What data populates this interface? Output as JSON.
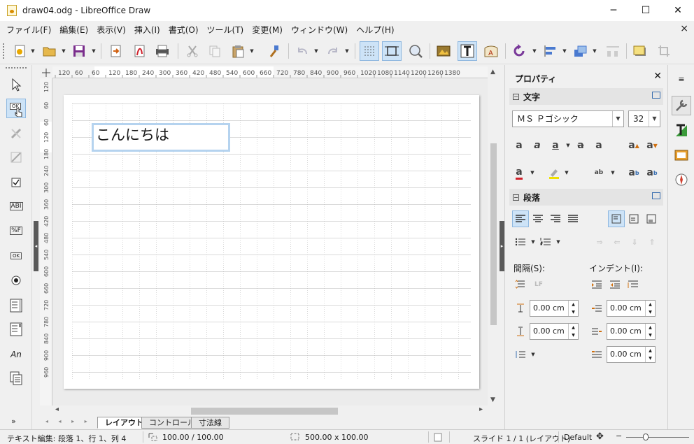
{
  "window": {
    "title": "draw04.odg - LibreOffice Draw",
    "minimize": "─",
    "maximize": "☐",
    "close": "✕"
  },
  "menu": {
    "items": [
      "ファイル(F)",
      "編集(E)",
      "表示(V)",
      "挿入(I)",
      "書式(O)",
      "ツール(T)",
      "変更(M)",
      "ウィンドウ(W)",
      "ヘルプ(H)"
    ],
    "close_doc": "×"
  },
  "toolbar": {
    "icons": [
      "new-document-icon",
      "open-icon",
      "save-icon",
      "export-icon",
      "export-pdf-icon",
      "print-icon",
      "cut-icon",
      "copy-icon",
      "paste-icon",
      "clone-formatting-icon",
      "undo-icon",
      "redo-icon",
      "grid-icon",
      "helplines-icon",
      "zoom-icon",
      "image-icon",
      "text-box-icon",
      "fontwork-icon",
      "rotate-icon",
      "align-icon",
      "arrange-icon",
      "distribute-icon",
      "shadow-icon",
      "crop-icon"
    ]
  },
  "controls_bar": {
    "more_label": "»",
    "icons": [
      "select-icon",
      "push-button-icon",
      "design-mode-icon",
      "control-properties-icon",
      "check-box-icon",
      "text-field-icon",
      "formatted-field-icon",
      "form-button-icon",
      "option-button-icon",
      "list-box-icon",
      "combo-box-icon",
      "label-field-icon",
      "form-navigator-icon"
    ],
    "labels": {
      "button": "OK",
      "text_field": "ABI",
      "formatted": "%F",
      "label": "An"
    }
  },
  "rulers": {
    "horizontal": [
      "120",
      "60",
      "60",
      "120",
      "180",
      "240",
      "300",
      "360",
      "420",
      "480",
      "540",
      "600",
      "660",
      "720",
      "780",
      "840",
      "900",
      "960",
      "1020",
      "1080",
      "1140",
      "1200",
      "1260",
      "1380"
    ],
    "vertical": [
      "120",
      "60",
      "60",
      "120",
      "180",
      "240",
      "300",
      "360",
      "420",
      "480",
      "540",
      "600",
      "660",
      "720",
      "780",
      "840",
      "900",
      "960"
    ]
  },
  "document": {
    "text_box_content": "こんにちは"
  },
  "tabs": {
    "nav": "◂ ◂ ▸ ▸",
    "items": [
      "レイアウト",
      "コントロール",
      "寸法線"
    ],
    "active_index": 0
  },
  "sidebar": {
    "title": "プロパティ",
    "close": "✕",
    "character": {
      "heading": "文字",
      "font_name": "ＭＳ Ｐゴシック",
      "font_size": "32"
    },
    "paragraph": {
      "heading": "段落",
      "spacing_label": "間隔(S):",
      "indent_label": "インデント(I):",
      "above_spacing": "0.00 cm",
      "below_spacing": "0.00 cm",
      "before_indent": "0.00 cm",
      "after_indent": "0.00 cm",
      "first_line_indent": "0.00 cm"
    }
  },
  "statusbar": {
    "edit_status": "テキスト編集: 段落 1、行 1、列 4",
    "position": "100.00 / 100.00",
    "size": "500.00 x 100.00",
    "slide": "スライド 1 / 1 (レイアウト)",
    "master": "Default",
    "zoom_minus": "−",
    "zoom_plus": "+"
  },
  "colors": {
    "accent_active": "#cde3f7",
    "textbox_border": "#b5d3ef",
    "page": "#ffffff"
  }
}
